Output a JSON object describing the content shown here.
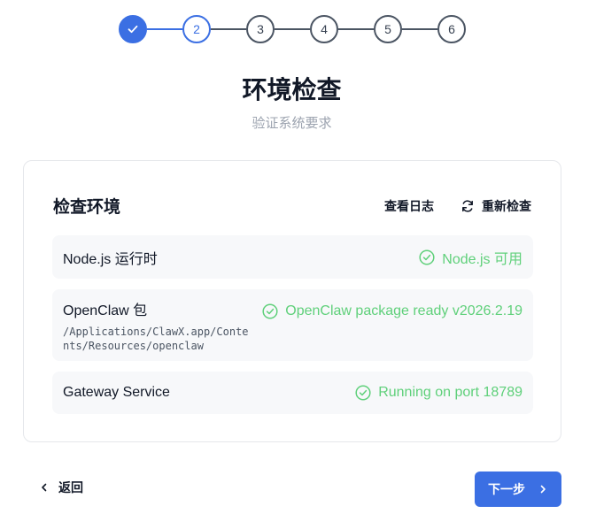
{
  "stepper": {
    "steps": [
      "✓",
      "2",
      "3",
      "4",
      "5",
      "6"
    ],
    "current": 2
  },
  "header": {
    "title": "环境检查",
    "subtitle": "验证系统要求"
  },
  "card": {
    "title": "检查环境",
    "view_logs_label": "查看日志",
    "recheck_label": "重新检查",
    "checks": [
      {
        "label": "Node.js 运行时",
        "status": "Node.js 可用"
      },
      {
        "label": "OpenClaw 包",
        "path": "/Applications/ClawX.app/Contents/Resources/openclaw",
        "status": "OpenClaw package ready v2026.2.19"
      },
      {
        "label": "Gateway Service",
        "status": "Running on port 18789"
      }
    ]
  },
  "footer": {
    "back_label": "返回",
    "next_label": "下一步"
  },
  "colors": {
    "accent": "#3b6fe3",
    "success": "#5fd07a"
  }
}
